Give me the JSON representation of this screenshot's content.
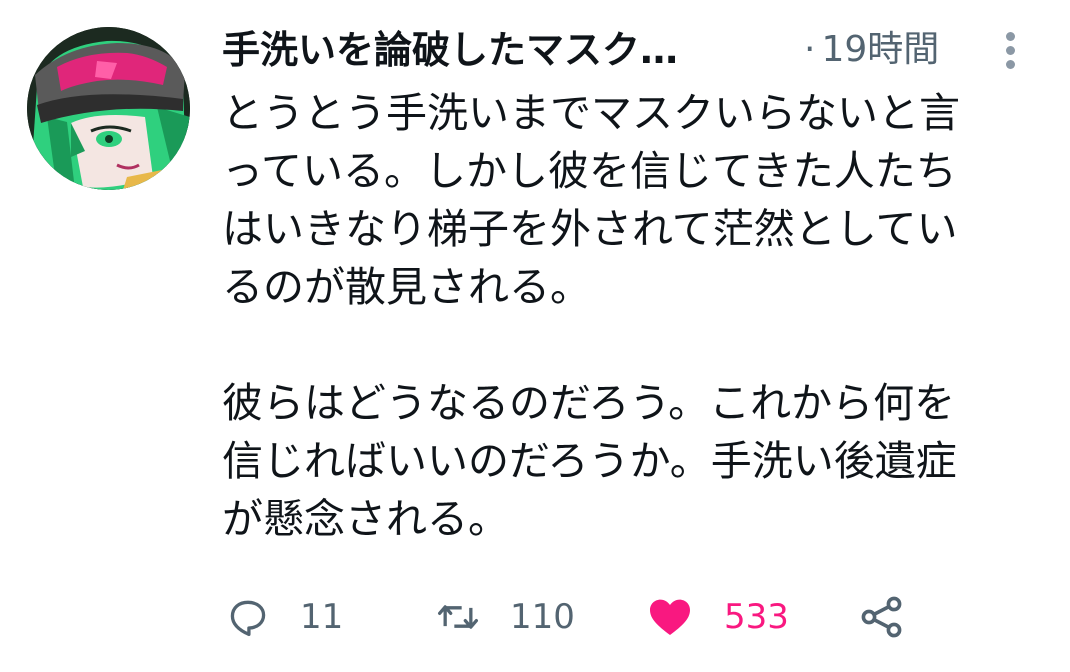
{
  "tweet": {
    "display_name": "手洗いを論破したマスク…",
    "separator": "·",
    "timestamp": "19時間",
    "paragraphs": [
      "とうとう手洗いまでマスクいらないと言\nっている。しかし彼を信じてきた人たち\nはいきなり梯子を外されて茫然としてい\nるのが散見される。",
      "彼らはどうなるのだろう。これから何を\n信じればいいのだろうか。手洗い後遺症\nが懸念される。"
    ],
    "reply_count": "11",
    "retweet_count": "110",
    "like_count": "533"
  },
  "icons": {
    "reply": "reply-bubble-icon",
    "retweet": "retweet-arrows-icon",
    "like": "heart-icon",
    "share": "share-icon",
    "more": "more-vertical-icon"
  },
  "colors": {
    "text": "#0f1419",
    "secondary": "#536471",
    "like_active": "#f91880",
    "avatar_ring": "#1c2a20",
    "avatar_hair": "#2fd07e",
    "avatar_hat": "#e0267a"
  }
}
